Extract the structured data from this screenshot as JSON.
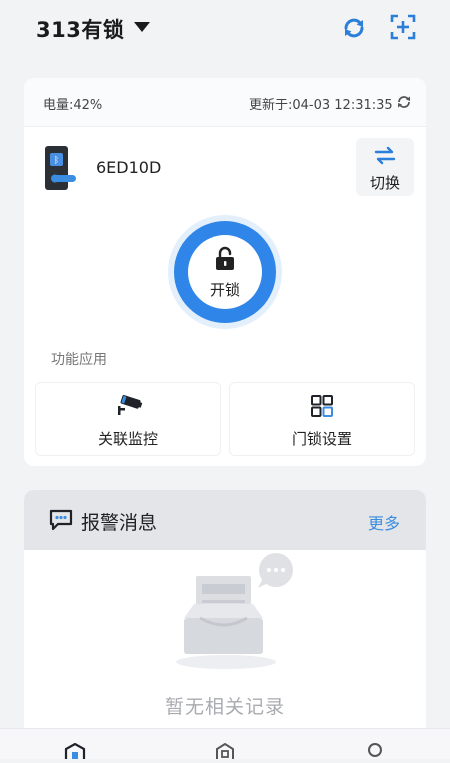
{
  "header": {
    "home_name": "313有锁",
    "refresh_icon": "refresh-icon",
    "scan_icon": "scan-add-icon"
  },
  "status": {
    "battery": "电量:42%",
    "updated": "更新于:04-03 12:31:35"
  },
  "device": {
    "name": "6ED10D",
    "switch_label": "切换",
    "unlock_label": "开锁"
  },
  "functions": {
    "section_title": "功能应用",
    "items": [
      {
        "label": "关联监控",
        "icon": "camera-icon"
      },
      {
        "label": "门锁设置",
        "icon": "grid-icon"
      }
    ]
  },
  "alarm": {
    "title": "报警消息",
    "more": "更多",
    "empty": "暂无相关记录"
  },
  "nav": {
    "icons": [
      "home-icon",
      "device-icon",
      "profile-icon"
    ]
  },
  "colors": {
    "accent": "#3a8de0",
    "unlock_ring": "#2f86e8",
    "background": "#f2f3f5"
  }
}
